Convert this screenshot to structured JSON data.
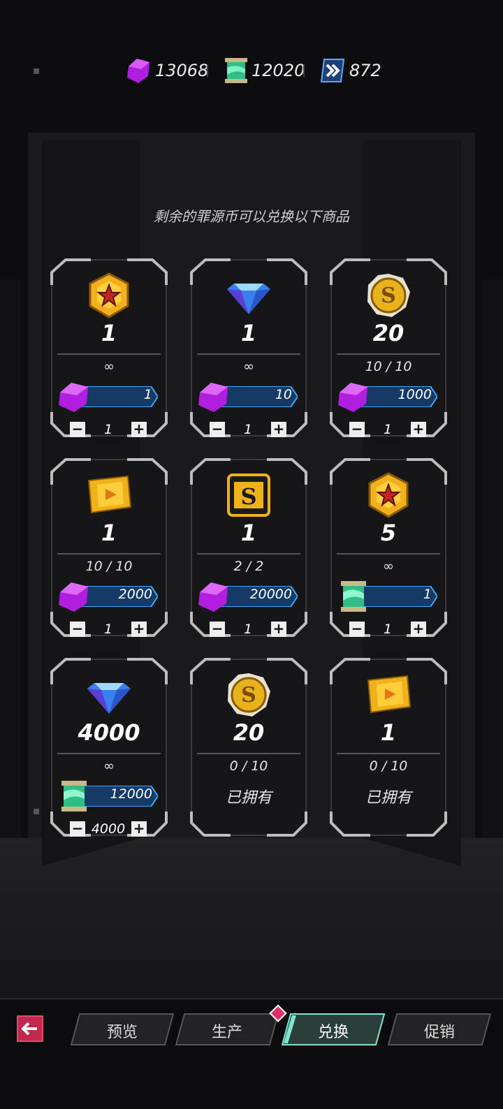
{
  "currencies": [
    {
      "icon": "purple-crystal-icon",
      "value": "13068"
    },
    {
      "icon": "green-scroll-icon",
      "value": "12020"
    },
    {
      "icon": "blue-chevron-badge-icon",
      "value": "872"
    }
  ],
  "subtitle": "剩余的罪源币可以兑换以下商品",
  "items": [
    {
      "icon": "gold-star-hexagon-icon",
      "amount": "1",
      "limit": "∞",
      "price_icon": "purple-crystal-icon",
      "price": "1",
      "qty": "1"
    },
    {
      "icon": "blue-diamond-icon",
      "amount": "1",
      "limit": "∞",
      "price_icon": "purple-crystal-icon",
      "price": "10",
      "qty": "1"
    },
    {
      "icon": "gold-s-coin-icon",
      "amount": "20",
      "limit": "10 / 10",
      "price_icon": "purple-crystal-icon",
      "price": "1000",
      "qty": "1"
    },
    {
      "icon": "gold-video-ticket-icon",
      "amount": "1",
      "limit": "10 / 10",
      "price_icon": "purple-crystal-icon",
      "price": "2000",
      "qty": "1"
    },
    {
      "icon": "gold-s-card-icon",
      "amount": "1",
      "limit": "2 / 2",
      "price_icon": "purple-crystal-icon",
      "price": "20000",
      "qty": "1"
    },
    {
      "icon": "gold-star-hexagon-icon",
      "amount": "5",
      "limit": "∞",
      "price_icon": "green-scroll-icon",
      "price": "1",
      "qty": "1"
    },
    {
      "icon": "blue-diamond-icon",
      "amount": "4000",
      "limit": "∞",
      "price_icon": "green-scroll-icon",
      "price": "12000",
      "qty": "4000"
    },
    {
      "icon": "gold-s-coin-icon",
      "amount": "20",
      "limit": "0 / 10",
      "owned": "已拥有"
    },
    {
      "icon": "gold-video-ticket-icon",
      "amount": "1",
      "limit": "0 / 10",
      "owned": "已拥有"
    }
  ],
  "nav": {
    "back_icon": "back-arrow-icon",
    "tabs": [
      {
        "label": "预览",
        "active": false
      },
      {
        "label": "生产",
        "active": false
      },
      {
        "label": "兑换",
        "active": true
      },
      {
        "label": "促销",
        "active": false
      }
    ]
  },
  "colors": {
    "accent": "#7fe6d2",
    "purple": "#b21ee0",
    "price_bar": "#163a66",
    "back": "#c2274e",
    "badge": "#e0306a"
  }
}
